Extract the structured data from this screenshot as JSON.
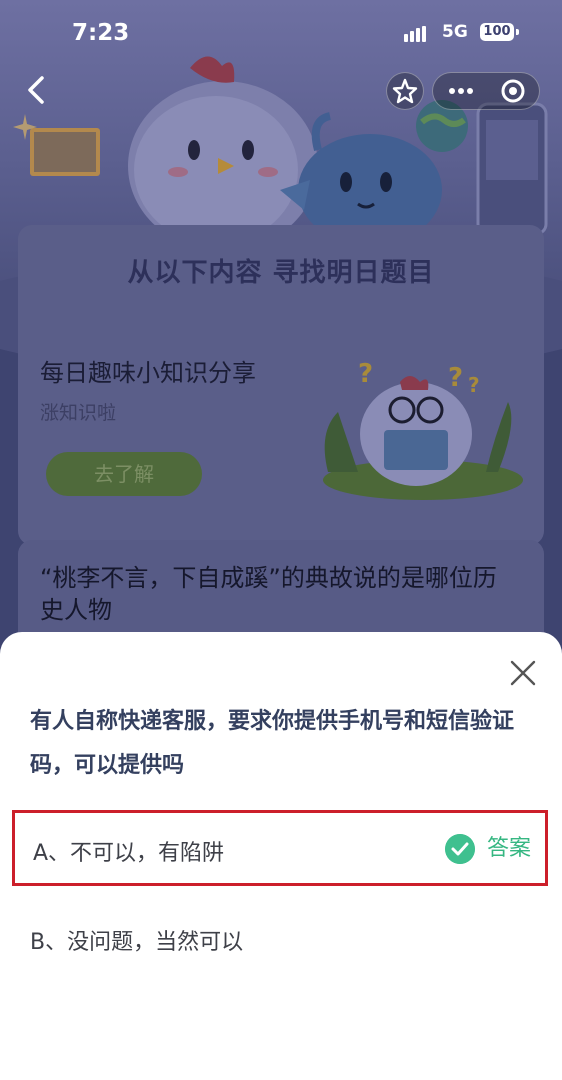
{
  "status_bar": {
    "time": "7:23",
    "network": "5G",
    "battery": "100"
  },
  "hero": {
    "card_title": "从以下内容  寻找明日题目"
  },
  "promo": {
    "title": "每日趣味小知识分享",
    "subtitle": "涨知识啦",
    "button": "去了解"
  },
  "question_card": {
    "text": "“桃李不言，下自成蹊”的典故说的是哪位历史人物"
  },
  "sheet": {
    "question": "有人自称快递客服，要求你提供手机号和短信验证码，可以提供吗",
    "options": [
      {
        "label": "A、不可以，有陷阱",
        "is_answer": true,
        "answer_tag": "答案"
      },
      {
        "label": "B、没问题，当然可以",
        "is_answer": false
      }
    ]
  },
  "colors": {
    "answer_green": "#3fc08f",
    "highlight_red": "#cc1f2a",
    "overlay": "#3e4470"
  },
  "icons": [
    "back-chevron-icon",
    "star-icon",
    "more-dots-icon",
    "close-target-icon",
    "close-icon",
    "check-circle-icon"
  ]
}
